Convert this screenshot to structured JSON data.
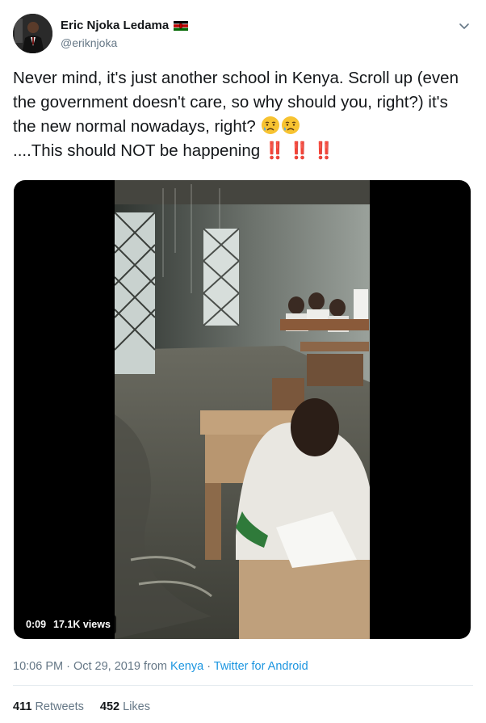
{
  "user": {
    "name": "Eric Njoka Ledama",
    "handle": "@eriknjoka"
  },
  "tweet": {
    "text_main": "Never mind, it's just another school in Kenya. Scroll up (even the government doesn't care, so why should you, right?) it's the new normal nowadays, right? ",
    "text_tail": "....This should NOT be happening",
    "emojis": [
      "disappointed-relieved-face",
      "disappointed-relieved-face"
    ],
    "exclamations": [
      "‼️",
      "‼️",
      "‼️"
    ]
  },
  "video": {
    "duration": "0:09",
    "views": "17.1K views"
  },
  "meta": {
    "time": "10:06 PM · Oct 29, 2019 from ",
    "location": "Kenya",
    "separator": " · ",
    "client": "Twitter for Android"
  },
  "stats": {
    "retweets_count": "411",
    "retweets_label": "Retweets",
    "likes_count": "452",
    "likes_label": "Likes"
  },
  "colors": {
    "link": "#1b95e0",
    "secondary": "#657786",
    "alert": "#d4202b"
  }
}
